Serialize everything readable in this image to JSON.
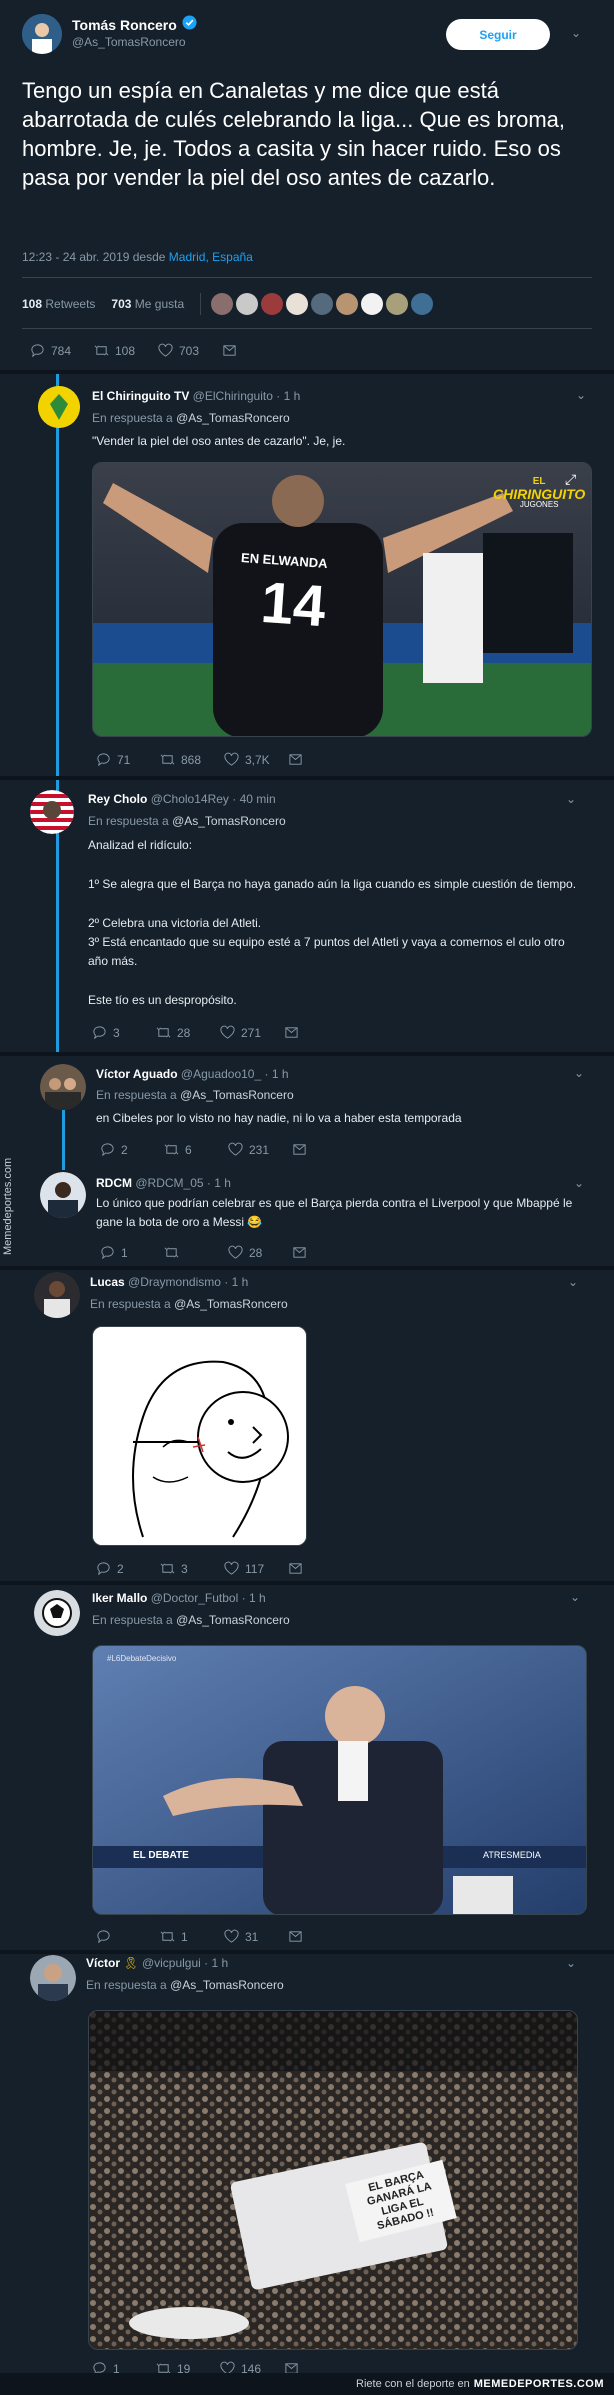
{
  "main": {
    "name": "Tomás Roncero",
    "handle": "@As_TomasRoncero",
    "follow_label": "Seguir",
    "text": "Tengo un espía en Canaletas y me dice que está abarrotada de culés celebrando la liga... Que es broma, hombre. Je, je. Todos a casita y sin hacer ruido. Eso os pasa por vender la piel del oso antes de cazarlo.",
    "timestamp": "12:23 - 24 abr. 2019 desde",
    "location": "Madrid, España",
    "retweets_count": "108",
    "retweets_label": "Retweets",
    "likes_count": "703",
    "likes_label": "Me gusta",
    "reply_count": "784",
    "rt_count": "108",
    "like_count": "703"
  },
  "replies": [
    {
      "name": "El Chiringuito TV",
      "handle": "@ElChiringuito",
      "time": "· 1 h",
      "reply_prefix": "En respuesta a",
      "reply_to": "@As_TomasRoncero",
      "text": "\"Vender la piel del oso antes de cazarlo\". Je, je.",
      "image_text": "EN ELWANDA",
      "image_number": "14",
      "image_logo": "CHIRINGUITO",
      "image_logo_sub": "JUGONES",
      "image_logo_el": "EL",
      "replies": "71",
      "retweets": "868",
      "likes": "3,7K"
    },
    {
      "name": "Rey Cholo",
      "handle": "@Cholo14Rey",
      "time": "· 40 min",
      "reply_prefix": "En respuesta a",
      "reply_to": "@As_TomasRoncero",
      "text_1": "Analizad el ridículo:",
      "text_2": "1º Se alegra que el Barça no haya ganado aún la liga cuando es simple cuestión de tiempo.",
      "text_3": "2º Celebra una victoria del Atleti.",
      "text_4": "3º Está encantado que su equipo esté a 7 puntos del Atleti y vaya a comernos el culo otro año más.",
      "text_5": "Este tío es un despropósito.",
      "replies": "3",
      "retweets": "28",
      "likes": "271"
    },
    {
      "name": "Víctor Aguado",
      "handle": "@Aguadoo10_",
      "time": "· 1 h",
      "reply_prefix": "En respuesta a",
      "reply_to": "@As_TomasRoncero",
      "text": "en Cibeles por lo visto no hay nadie, ni lo va a haber esta temporada",
      "replies": "2",
      "retweets": "6",
      "likes": "231"
    },
    {
      "name": "RDCM",
      "handle": "@RDCM_05",
      "time": "· 1 h",
      "text": "Lo único que podrían celebrar es que el Barça pierda contra el Liverpool y que Mbappé le gane la bota de oro a Messi 😂",
      "replies": "1",
      "retweets": "",
      "likes": "28"
    },
    {
      "name": "Lucas",
      "handle": "@Draymondismo",
      "time": "· 1 h",
      "reply_prefix": "En respuesta a",
      "reply_to": "@As_TomasRoncero",
      "replies": "2",
      "retweets": "3",
      "likes": "117"
    },
    {
      "name": "Iker Mallo",
      "handle": "@Doctor_Futbol",
      "time": "· 1 h",
      "reply_prefix": "En respuesta a",
      "reply_to": "@As_TomasRoncero",
      "image_tag": "#L6DebateDecisivo",
      "image_band_1": "EL DEBATE",
      "image_band_2": "ATRESMEDIA",
      "replies": "",
      "retweets": "1",
      "likes": "31"
    },
    {
      "name": "Víctor",
      "handle": "@vicpulgui",
      "time": "· 1 h",
      "reply_prefix": "En respuesta a",
      "reply_to": "@As_TomasRoncero",
      "image_sign": "EL BARÇA GANARÁ LA LIGA EL SÁBADO !!",
      "replies": "1",
      "retweets": "19",
      "likes": "146"
    }
  ],
  "watermark": {
    "side": "Memedeportes.com",
    "footer_prefix": "Riete con el deporte en",
    "footer_brand": "MEMEDEPORTES.COM"
  },
  "colors": {
    "background": "#15202b",
    "accent": "#1da1f2",
    "thread_line": "#1f9ce0"
  }
}
